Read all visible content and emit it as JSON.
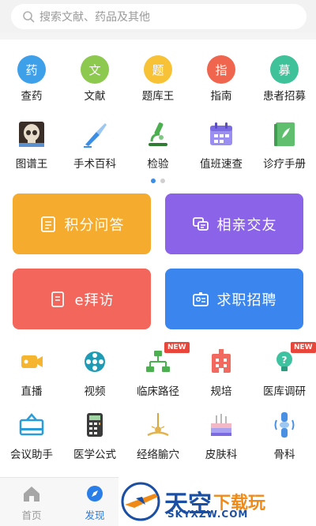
{
  "search": {
    "placeholder": "搜索文献、药品及其他"
  },
  "row1": [
    {
      "icon_char": "药",
      "label": "查药",
      "color": "#3fa0ea"
    },
    {
      "icon_char": "文",
      "label": "文献",
      "color": "#8cc94e"
    },
    {
      "icon_char": "题",
      "label": "题库王",
      "color": "#f7c235"
    },
    {
      "icon_char": "指",
      "label": "指南",
      "color": "#f0654d"
    },
    {
      "icon_char": "募",
      "label": "患者招募",
      "color": "#3fc29a"
    }
  ],
  "row2": [
    {
      "icon": "skull-xray-icon",
      "label": "图谱王"
    },
    {
      "icon": "scalpel-icon",
      "label": "手术百科"
    },
    {
      "icon": "microscope-icon",
      "label": "检验"
    },
    {
      "icon": "calendar-icon",
      "label": "值班速查"
    },
    {
      "icon": "handbook-icon",
      "label": "诊疗手册"
    }
  ],
  "cards": [
    {
      "label": "积分问答",
      "color": "#f5ac2e",
      "icon": "qa-list-icon"
    },
    {
      "label": "相亲交友",
      "color": "#8a63e8",
      "icon": "chat-icon"
    },
    {
      "label": "e拜访",
      "color": "#f2665c",
      "icon": "document-icon"
    },
    {
      "label": "求职招聘",
      "color": "#3a86ee",
      "icon": "id-card-icon"
    }
  ],
  "row3": [
    {
      "icon": "live-camera-icon",
      "label": "直播"
    },
    {
      "icon": "film-reel-icon",
      "label": "视频"
    },
    {
      "icon": "flowchart-icon",
      "label": "临床路径",
      "badge": "NEW"
    },
    {
      "icon": "hospital-icon",
      "label": "规培"
    },
    {
      "icon": "lightbulb-icon",
      "label": "医库调研",
      "badge": "NEW"
    }
  ],
  "row4": [
    {
      "icon": "meeting-icon",
      "label": "会议助手"
    },
    {
      "icon": "calculator-icon",
      "label": "医学公式"
    },
    {
      "icon": "acupoint-icon",
      "label": "经络腧穴"
    },
    {
      "icon": "skin-icon",
      "label": "皮肤科"
    },
    {
      "icon": "bone-joint-icon",
      "label": "骨科"
    }
  ],
  "tabbar": [
    {
      "icon": "home-icon",
      "label": "首页",
      "color": "#999999"
    },
    {
      "icon": "compass-icon",
      "label": "发现",
      "color": "#2a7ee8"
    }
  ],
  "watermark": {
    "title": "天空",
    "subtitle": "下载玩",
    "url": "SKYXZW.COM"
  }
}
